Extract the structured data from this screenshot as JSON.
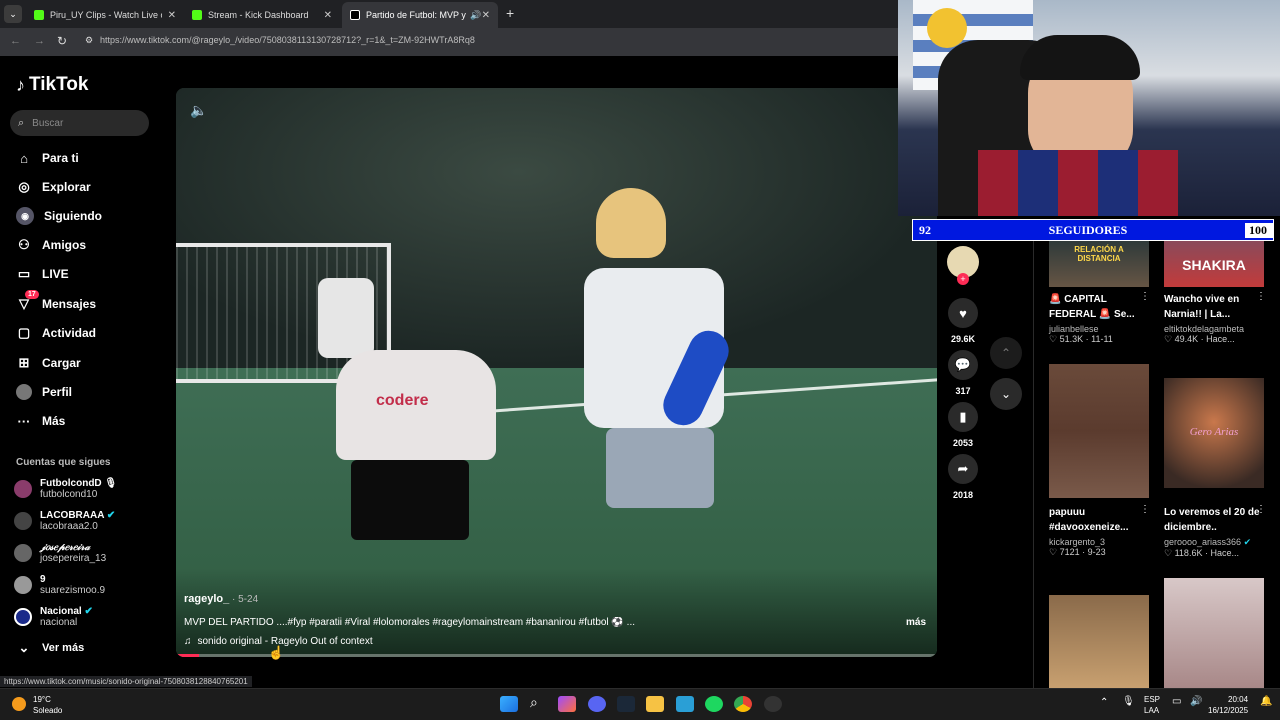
{
  "browser": {
    "tabs": [
      {
        "title": "Piru_UY Clips - Watch Live on K",
        "color": "#53fc18"
      },
      {
        "title": "Stream - Kick Dashboard",
        "color": "#53fc18"
      },
      {
        "title": "Partido de Futbol: MVP y M",
        "color": "#ffffff"
      }
    ],
    "url": "https://www.tiktok.com/@rageylo_/video/7508038113130728712?_r=1&_t=ZM-92HWTrA8Rq8",
    "status_url": "https://www.tiktok.com/music/sonido-original-7508038128840765201"
  },
  "sidebar": {
    "logo": "TikTok",
    "search_placeholder": "Buscar",
    "nav": [
      {
        "label": "Para ti",
        "icon": "home-icon"
      },
      {
        "label": "Explorar",
        "icon": "compass-icon"
      },
      {
        "label": "Siguiendo",
        "icon": "following-icon"
      },
      {
        "label": "Amigos",
        "icon": "friends-icon"
      },
      {
        "label": "LIVE",
        "icon": "live-icon"
      },
      {
        "label": "Mensajes",
        "icon": "messages-icon",
        "badge": "17"
      },
      {
        "label": "Actividad",
        "icon": "activity-icon"
      },
      {
        "label": "Cargar",
        "icon": "upload-icon"
      },
      {
        "label": "Perfil",
        "icon": "profile-icon"
      },
      {
        "label": "Más",
        "icon": "more-icon"
      }
    ],
    "following_heading": "Cuentas que sigues",
    "accounts": [
      {
        "name": "FutbolcondD 🎙",
        "handle": "futbolcond10"
      },
      {
        "name": "LACOBRAAA",
        "handle": "lacobraaa2.0"
      },
      {
        "name": "𝒿𝑜𝓈𝑒𝓅𝑒𝓇𝑒𝒾𝓇𝒶",
        "handle": "josepereira_13"
      },
      {
        "name": "9",
        "handle": "suarezismoo.9"
      },
      {
        "name": "Nacional",
        "handle": "nacional"
      }
    ],
    "see_more": "Ver más"
  },
  "video": {
    "author": "rageylo_",
    "date": "5-24",
    "caption": "MVP DEL PARTIDO ....#fyp #paratii #Viral #lolomorales #rageylomainstream #bananirou #futbol ⚽ ...",
    "more": "más",
    "sound": "sonido original - Rageylo Out of context",
    "shirt_text": "codere",
    "progress": 0.03
  },
  "actions": {
    "likes": "29.6K",
    "comments": "317",
    "saves": "2053",
    "shares": "2018"
  },
  "feed": [
    {
      "thumb_text": "RELACIÓN A DISTANCIA",
      "title": "🚨 CAPITAL FEDERAL 🚨 Se...",
      "author": "julianbellese",
      "likes": "51.3K",
      "date": "11-11"
    },
    {
      "thumb_text": "SHAKIRA",
      "title": "Wancho vive en Narnia!! | La...",
      "author": "eltiktokdelagambeta",
      "likes": "49.4K",
      "date": "Hace..."
    },
    {
      "thumb_text": "",
      "title": "papuuu #davooxeneize...",
      "author": "kickargento_3",
      "likes": "7121",
      "date": "9-23"
    },
    {
      "thumb_text": "Gero Arias",
      "title": "Lo veremos el 20 de diciembre..",
      "author": "geroooo_ariass366",
      "likes": "118.6K",
      "date": "Hace..."
    }
  ],
  "stream_overlay": {
    "left": "92",
    "label": "SEGUIDORES",
    "right": "100"
  },
  "taskbar": {
    "temp": "19°C",
    "weather": "Soleado",
    "lang1": "ESP",
    "lang2": "LAA",
    "time": "20:04",
    "date": "16/12/2025"
  }
}
